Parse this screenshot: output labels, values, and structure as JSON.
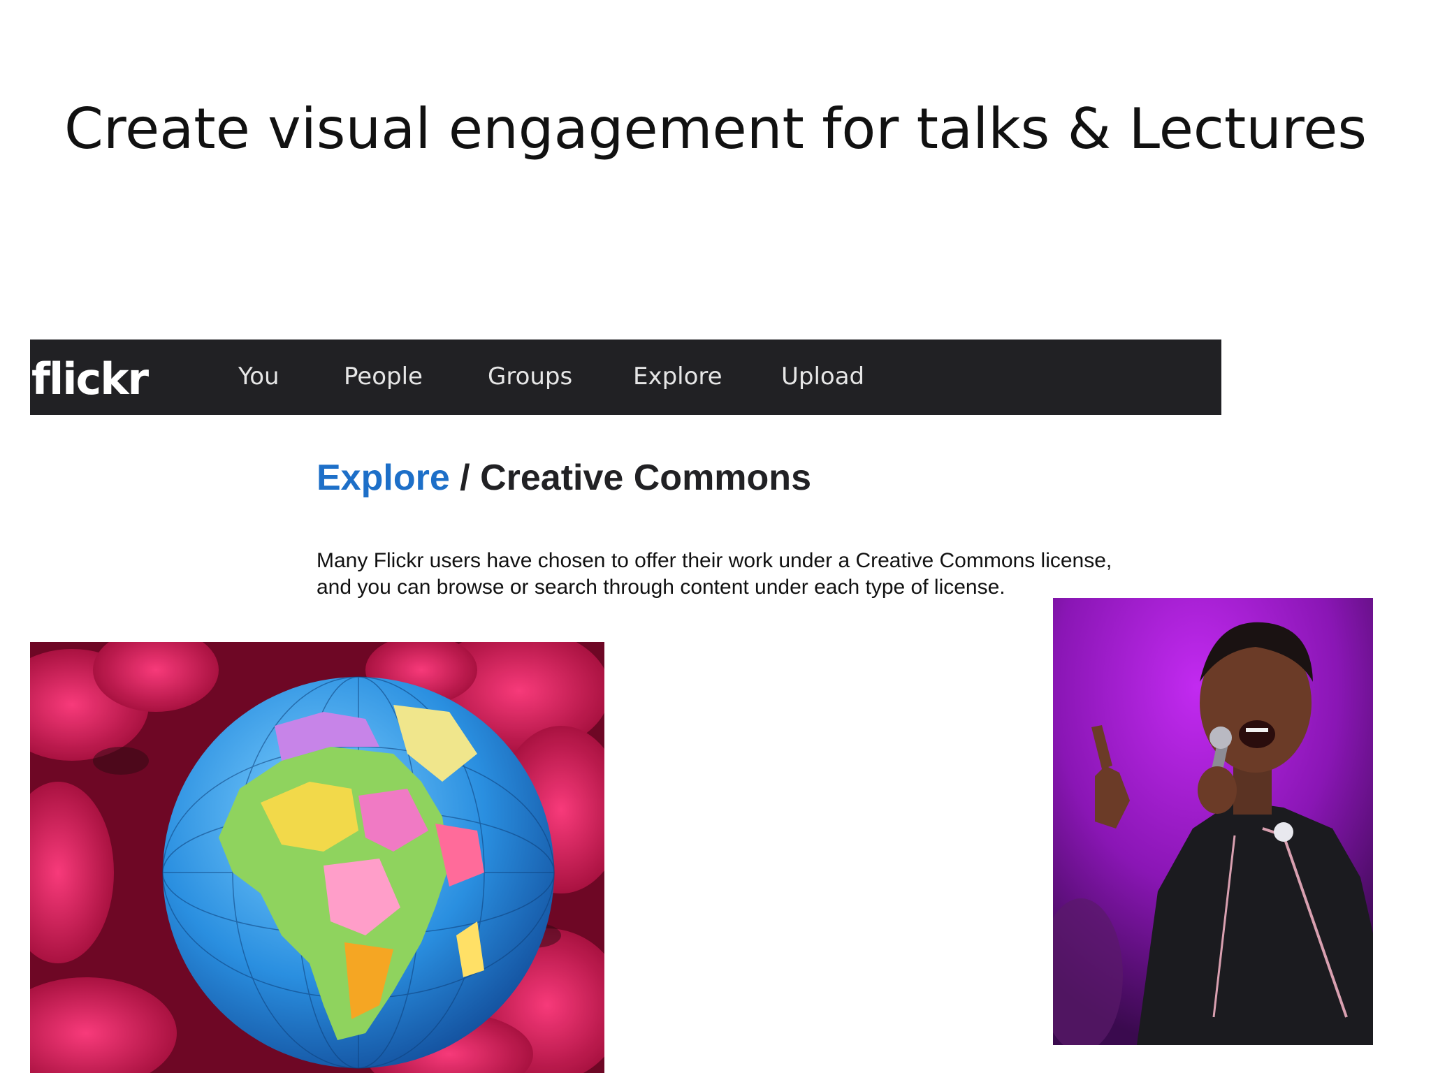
{
  "slide": {
    "title": "Create visual engagement for talks & Lectures"
  },
  "flickr": {
    "logo": "flickr",
    "nav": [
      "You",
      "People",
      "Groups",
      "Explore",
      "Upload"
    ],
    "breadcrumb_link": "Explore",
    "breadcrumb_separator": " / ",
    "page_title": "Creative Commons",
    "description_line1": "Many Flickr users have chosen to offer their work under a Creative Commons license,",
    "description_line2": "and you can browse or search through content under each type of license."
  },
  "colors": {
    "navbar_bg": "#212124",
    "link_blue": "#1d6fc8",
    "flowers_pink": "#e0135a",
    "stage_purple": "#9b1fc9"
  }
}
